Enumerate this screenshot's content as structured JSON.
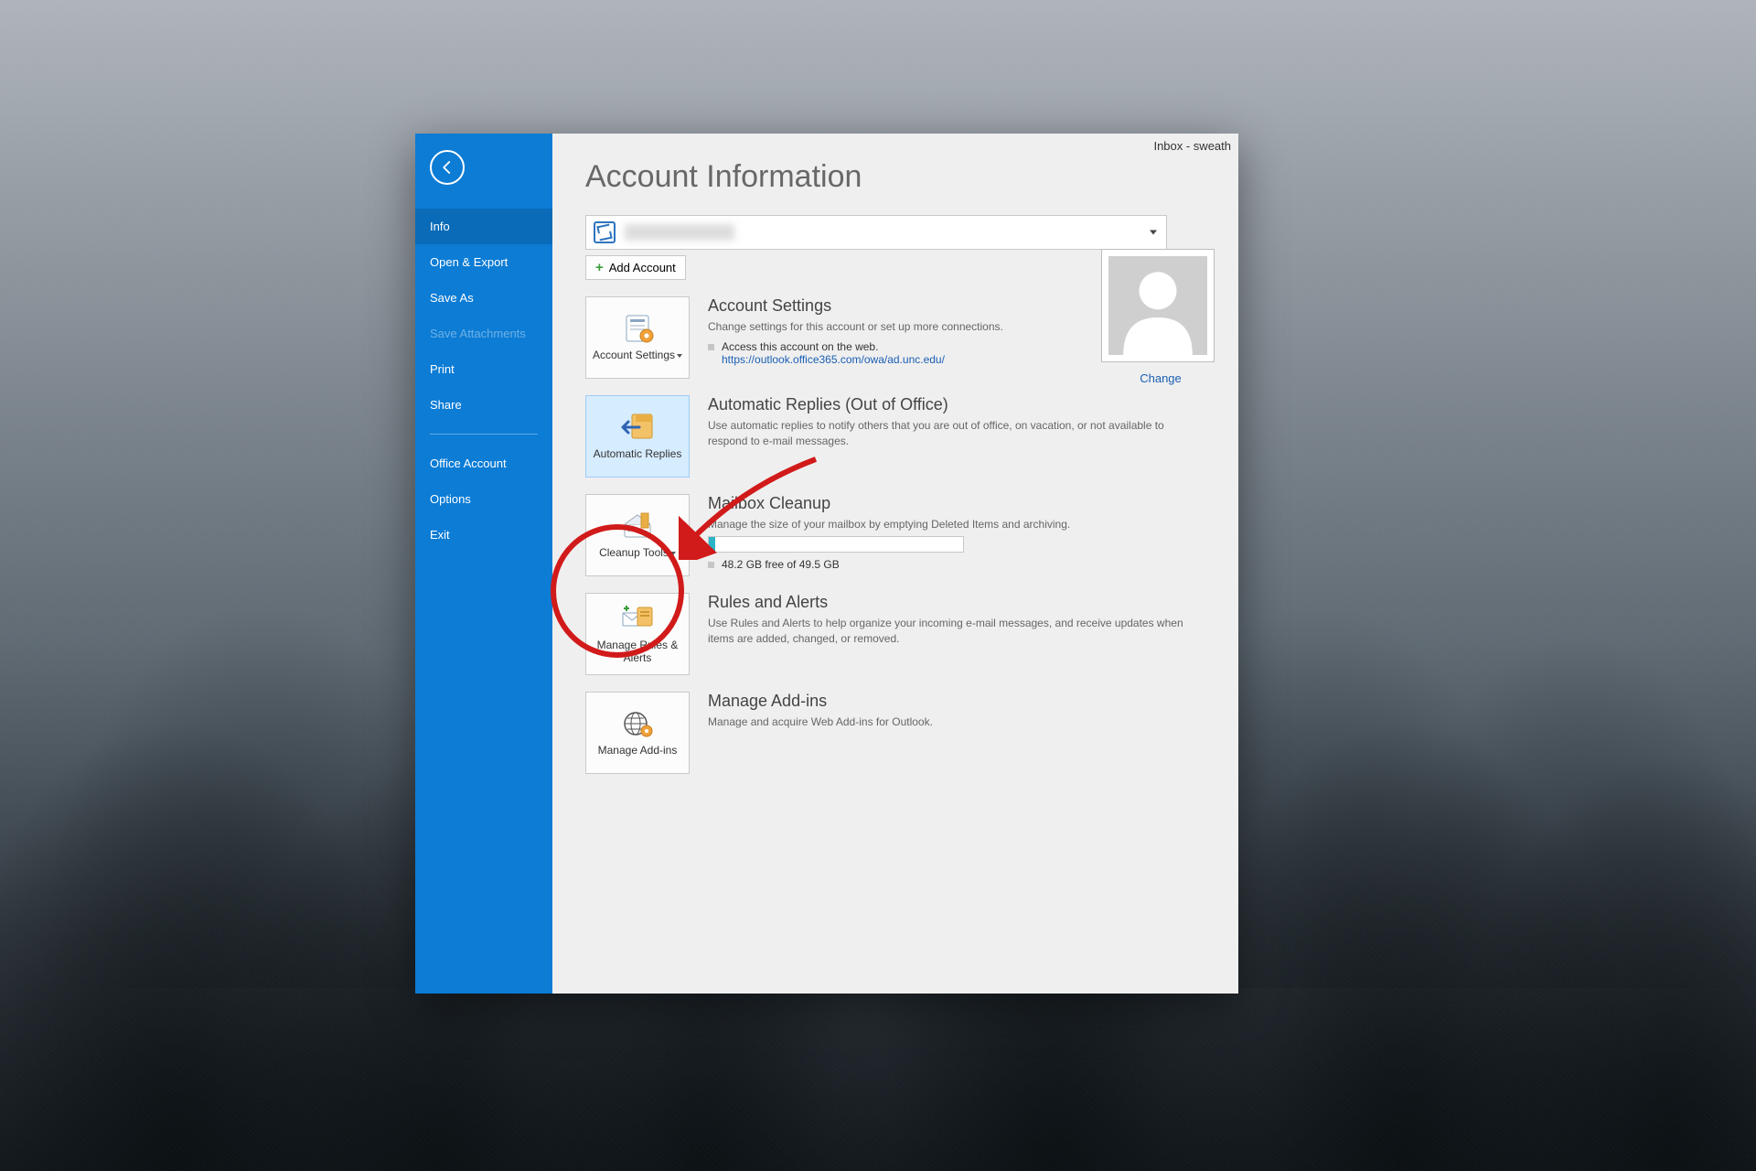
{
  "window": {
    "title_text": "Inbox - sweath"
  },
  "sidebar": {
    "items": [
      {
        "label": "Info",
        "state": "active"
      },
      {
        "label": "Open & Export",
        "state": ""
      },
      {
        "label": "Save As",
        "state": ""
      },
      {
        "label": "Save Attachments",
        "state": "disabled"
      },
      {
        "label": "Print",
        "state": ""
      },
      {
        "label": "Share",
        "state": ""
      },
      {
        "label": "Office Account",
        "state": ""
      },
      {
        "label": "Options",
        "state": ""
      },
      {
        "label": "Exit",
        "state": ""
      }
    ]
  },
  "page": {
    "title": "Account Information",
    "add_account": "Add Account",
    "avatar": {
      "change_label": "Change"
    }
  },
  "tiles": {
    "account_settings": "Account Settings",
    "automatic_replies": "Automatic Replies",
    "cleanup_tools": "Cleanup Tools",
    "manage_rules": "Manage Rules & Alerts",
    "manage_addins": "Manage Add-ins"
  },
  "sections": {
    "account_settings": {
      "title": "Account Settings",
      "desc": "Change settings for this account or set up more connections.",
      "bullet": "Access this account on the web.",
      "url": "https://outlook.office365.com/owa/ad.unc.edu/"
    },
    "auto_replies": {
      "title": "Automatic Replies (Out of Office)",
      "desc": "Use automatic replies to notify others that you are out of office, on vacation, or not available to respond to e-mail messages."
    },
    "mailbox": {
      "title": "Mailbox Cleanup",
      "desc": "Manage the size of your mailbox by emptying Deleted Items and archiving.",
      "storage_text": "48.2 GB free of 49.5 GB",
      "used_fraction": 0.026
    },
    "rules": {
      "title": "Rules and Alerts",
      "desc": "Use Rules and Alerts to help organize your incoming e-mail messages, and receive updates when items are added, changed, or removed."
    },
    "addins": {
      "title": "Manage Add-ins",
      "desc": "Manage and acquire Web Add-ins for Outlook."
    }
  }
}
